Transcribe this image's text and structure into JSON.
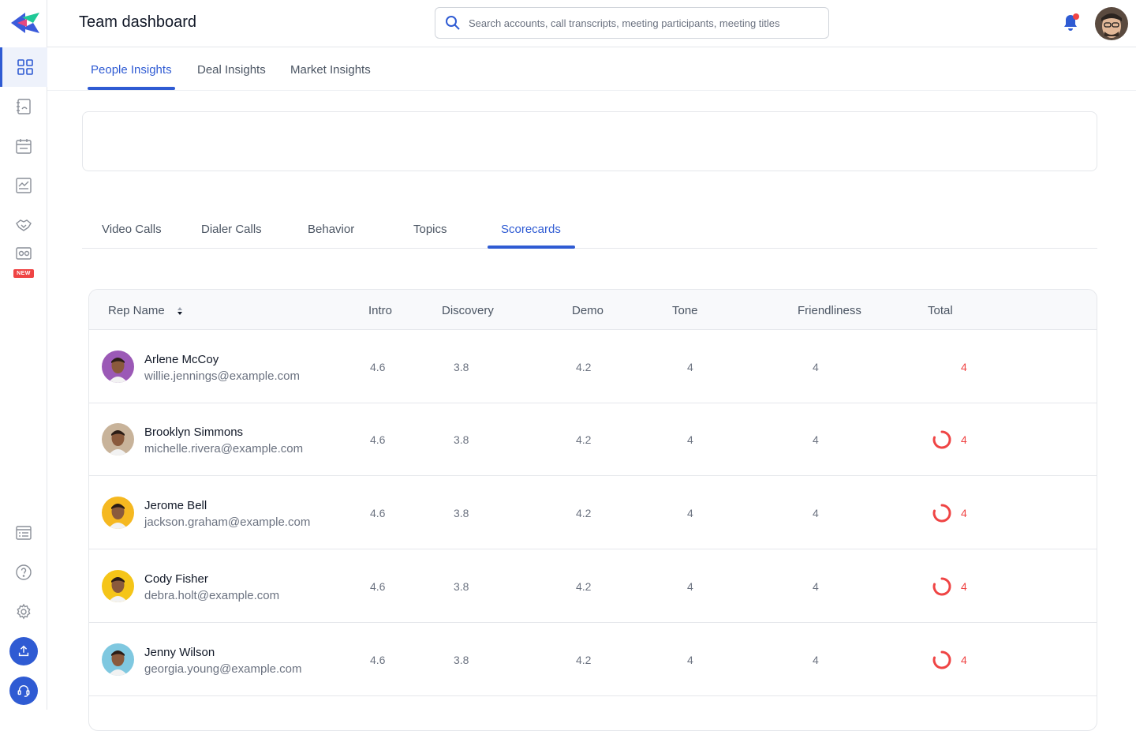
{
  "header": {
    "title": "Team dashboard",
    "search_placeholder": "Search accounts, call transcripts, meeting participants, meeting titles"
  },
  "sidebar": {
    "items": [
      {
        "name": "dashboard-icon",
        "active": true
      },
      {
        "name": "contacts-book-icon",
        "active": false
      },
      {
        "name": "calendar-icon",
        "active": false
      },
      {
        "name": "report-chart-icon",
        "active": false
      },
      {
        "name": "handshake-icon",
        "active": false
      },
      {
        "name": "radio-icon",
        "active": false
      }
    ],
    "new_badge": "NEW",
    "bottom_items": [
      "list-icon",
      "help-icon",
      "settings-icon",
      "upload-icon",
      "support-headset-icon"
    ]
  },
  "top_tabs": [
    {
      "label": "People Insights",
      "active": true
    },
    {
      "label": "Deal Insights",
      "active": false
    },
    {
      "label": "Market Insights",
      "active": false
    }
  ],
  "sub_tabs": [
    {
      "label": "Video Calls",
      "active": false
    },
    {
      "label": "Dialer Calls",
      "active": false
    },
    {
      "label": "Behavior",
      "active": false
    },
    {
      "label": "Topics",
      "active": false
    },
    {
      "label": "Scorecards",
      "active": true
    }
  ],
  "table": {
    "columns": [
      "Rep Name",
      "Intro",
      "Discovery",
      "Demo",
      "Tone",
      "Friendliness",
      "Total"
    ],
    "rows": [
      {
        "name": "Arlene McCoy",
        "email": "willie.jennings@example.com",
        "intro": "4.6",
        "discovery": "3.8",
        "demo": "4.2",
        "tone": "4",
        "friendliness": "4",
        "total": "4",
        "spinner": false,
        "avatar_color": "#9b59b6"
      },
      {
        "name": "Brooklyn Simmons",
        "email": "michelle.rivera@example.com",
        "intro": "4.6",
        "discovery": "3.8",
        "demo": "4.2",
        "tone": "4",
        "friendliness": "4",
        "total": "4",
        "spinner": true,
        "avatar_color": "#c8b39a"
      },
      {
        "name": "Jerome Bell",
        "email": "jackson.graham@example.com",
        "intro": "4.6",
        "discovery": "3.8",
        "demo": "4.2",
        "tone": "4",
        "friendliness": "4",
        "total": "4",
        "spinner": true,
        "avatar_color": "#f5b820"
      },
      {
        "name": "Cody Fisher",
        "email": "debra.holt@example.com",
        "intro": "4.6",
        "discovery": "3.8",
        "demo": "4.2",
        "tone": "4",
        "friendliness": "4",
        "total": "4",
        "spinner": true,
        "avatar_color": "#f5c518"
      },
      {
        "name": "Jenny Wilson",
        "email": "georgia.young@example.com",
        "intro": "4.6",
        "discovery": "3.8",
        "demo": "4.2",
        "tone": "4",
        "friendliness": "4",
        "total": "4",
        "spinner": true,
        "avatar_color": "#7fc8e0"
      }
    ]
  },
  "colors": {
    "accent": "#2f5bd3",
    "total": "#ef4444",
    "notification_dot": "#ef4444"
  }
}
